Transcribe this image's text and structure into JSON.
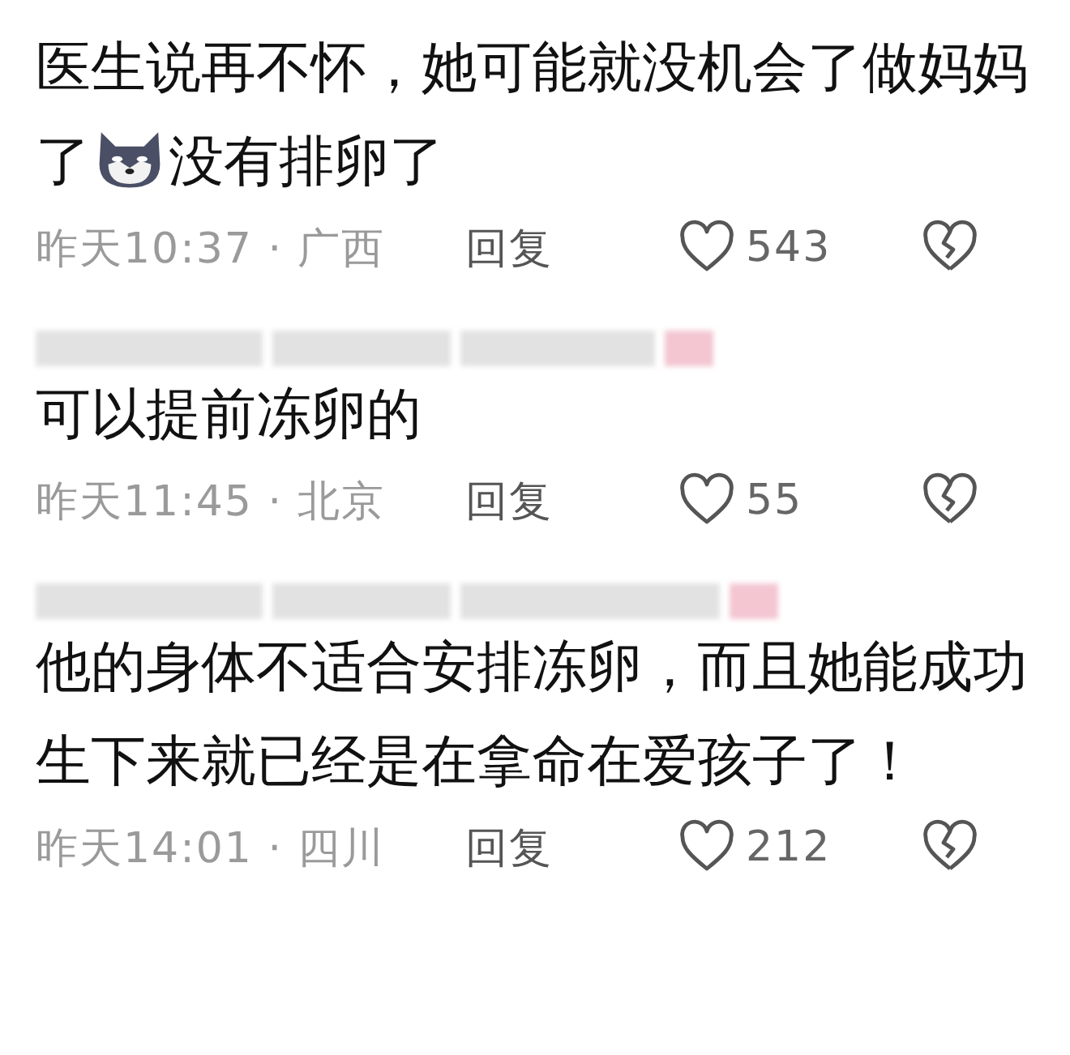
{
  "comments": [
    {
      "name_blurred": false,
      "body": [
        {
          "kind": "text",
          "text": "医生说再不怀，她可能就没机会了做妈妈了"
        },
        {
          "kind": "emoji"
        },
        {
          "kind": "text",
          "text": "没有排卵了"
        }
      ],
      "time": "昨天10:37 · 广西",
      "reply": "回复",
      "likes": "543"
    },
    {
      "name_blurred": true,
      "body": [
        {
          "kind": "text",
          "text": "可以提前冻卵的"
        }
      ],
      "time": "昨天11:45 · 北京",
      "reply": "回复",
      "likes": "55"
    },
    {
      "name_blurred": true,
      "body": [
        {
          "kind": "text",
          "text": "他的身体不适合安排冻卵，而且她能成功生下来就已经是在拿命在爱孩子了！"
        }
      ],
      "time": "昨天14:01 · 四川",
      "reply": "回复",
      "likes": "212"
    }
  ]
}
